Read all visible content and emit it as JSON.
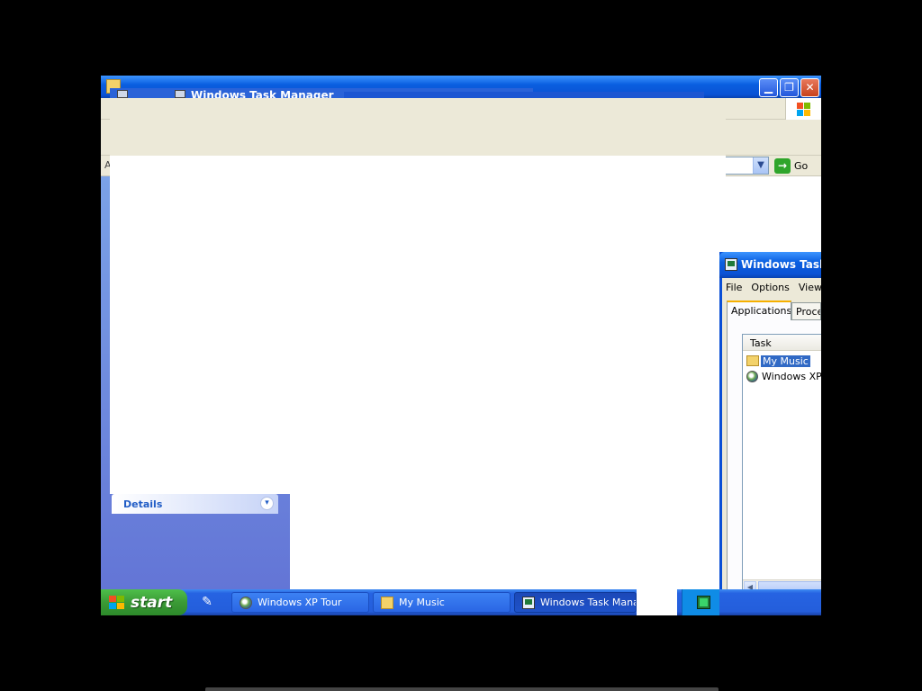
{
  "explorer": {
    "go_label": "Go",
    "address_letter": "A",
    "details_label": "Details",
    "caption_minimize": "▁",
    "caption_maximize": "❐",
    "caption_close": "✕"
  },
  "ghost_window": {
    "title": "Windows Task Manager"
  },
  "taskmanager": {
    "title": "Windows Task",
    "menu": [
      "File",
      "Options",
      "View"
    ],
    "tabs": [
      "Applications",
      "Proce"
    ],
    "column_header": "Task",
    "tasks": [
      {
        "name": "My Music",
        "icon": "folder-icon",
        "selected": true
      },
      {
        "name": "Windows XP",
        "icon": "globe-icon",
        "selected": false
      }
    ]
  },
  "taskbar": {
    "start_label": "start",
    "buttons": [
      {
        "label": "Windows XP Tour",
        "icon": "tour-icon"
      },
      {
        "label": "My Music",
        "icon": "folder-icon"
      },
      {
        "label": "Windows Task Manage",
        "icon": "taskmanager-icon"
      }
    ]
  },
  "colors": {
    "titlebar_blue": "#0a52d4",
    "taskbar_blue": "#245edb",
    "start_green": "#3b9a36",
    "selection_blue": "#316ac5"
  }
}
